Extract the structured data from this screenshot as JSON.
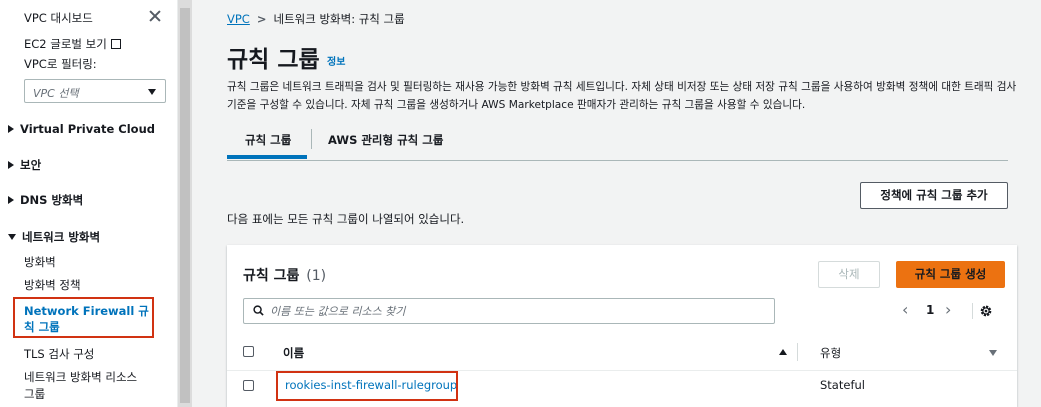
{
  "sidebar": {
    "dashboard": "VPC 대시보드",
    "ec2_global": "EC2 글로벌 보기",
    "filter_label": "VPC로 필터링:",
    "vpc_select_placeholder": "VPC 선택",
    "sections": {
      "vpc": "Virtual Private Cloud",
      "security": "보안",
      "dns_firewall": "DNS 방화벽",
      "network_firewall": "네트워크 방화벽"
    },
    "items": {
      "firewalls": "방화벽",
      "firewall_policies": "방화벽 정책",
      "rule_groups": "Network Firewall 규칙 그룹",
      "tls_inspection": "TLS 검사 구성",
      "resource_groups": "네트워크 방화벽 리소스 그룹"
    }
  },
  "breadcrumb": {
    "root": "VPC",
    "current": "네트워크 방화벽: 규칙 그룹"
  },
  "page": {
    "title": "규칙 그룹",
    "info": "정보",
    "description": "규칙 그룹은 네트워크 트래픽을 검사 및 필터링하는 재사용 가능한 방화벽 규칙 세트입니다. 자체 상태 비저장 또는 상태 저장 규칙 그룹을 사용하여 방화벽 정책에 대한 트래픽 검사 기준을 구성할 수 있습니다. 자체 규칙 그룹을 생성하거나 AWS Marketplace 판매자가 관리하는 규칙 그룹을 사용할 수 있습니다."
  },
  "tabs": [
    {
      "label": "규칙 그룹",
      "active": true
    },
    {
      "label": "AWS 관리형 규칙 그룹",
      "active": false
    }
  ],
  "add_to_policy_button": "정책에 규칙 그룹 추가",
  "table_note": "다음 표에는 모든 규칙 그룹이 나열되어 있습니다.",
  "panel": {
    "title": "규칙 그룹",
    "count": "(1)",
    "delete_button": "삭제",
    "create_button": "규칙 그룹 생성",
    "search_placeholder": "이름 또는 값으로 리소스 찾기",
    "page_number": "1",
    "columns": {
      "name": "이름",
      "type": "유형"
    },
    "rows": [
      {
        "name": "rookies-inst-firewall-rulegroup",
        "type": "Stateful"
      }
    ]
  },
  "colors": {
    "link": "#0073bb",
    "primary_button": "#ec7211",
    "highlight": "#d13212"
  }
}
